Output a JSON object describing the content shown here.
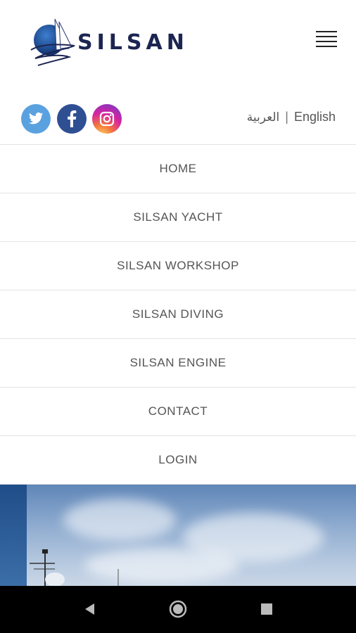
{
  "brand": {
    "name": "SILSAN"
  },
  "social": [
    {
      "name": "twitter-icon",
      "color": "#5aa2df"
    },
    {
      "name": "facebook-icon",
      "color": "#2f4f93"
    },
    {
      "name": "instagram-icon",
      "color": "#d6249f"
    }
  ],
  "language": {
    "arabic": "العربية",
    "separator": "|",
    "english": "English"
  },
  "menu": {
    "items": [
      {
        "label": "HOME"
      },
      {
        "label": "SILSAN YACHT"
      },
      {
        "label": "SILSAN WORKSHOP"
      },
      {
        "label": "SILSAN DIVING"
      },
      {
        "label": "SILSAN ENGINE"
      },
      {
        "label": "CONTACT"
      },
      {
        "label": "LOGIN"
      }
    ]
  },
  "system_nav": {
    "back": "back-icon",
    "home": "home-icon",
    "recents": "recents-icon"
  }
}
